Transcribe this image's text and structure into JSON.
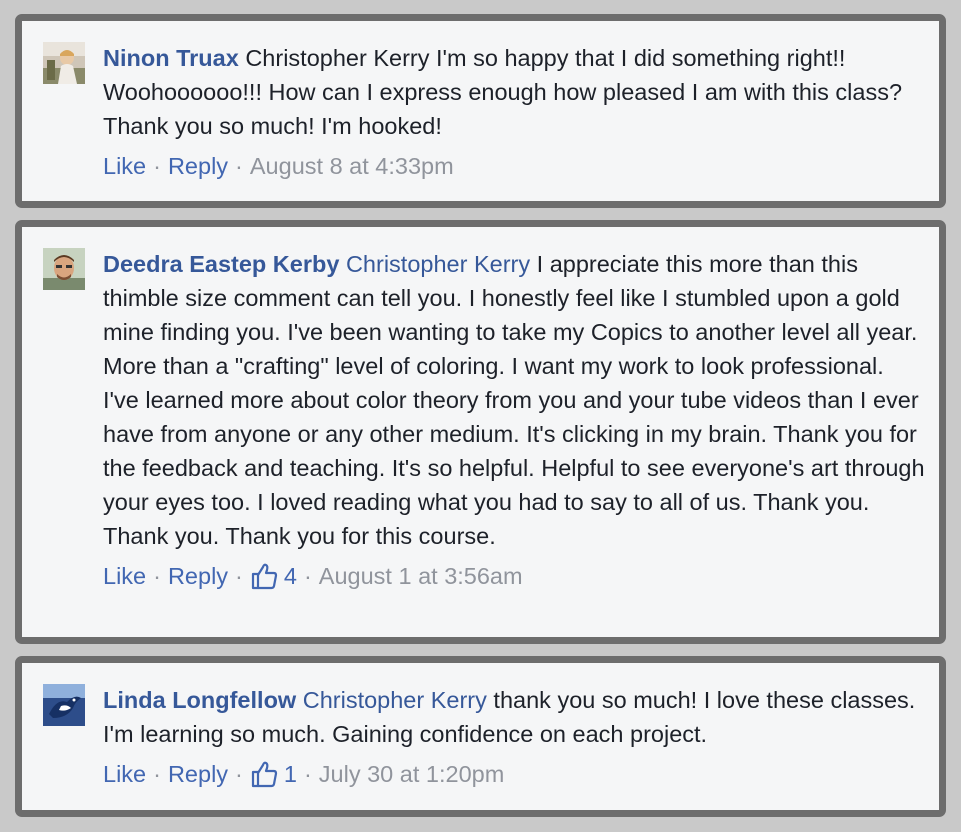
{
  "comments": [
    {
      "author": "Ninon Truax",
      "mention": "",
      "text": "Christopher Kerry I'm so happy that I did something right!! Woohoooooo!!! How can I express enough how pleased I am with this class? Thank you so much! I'm hooked!",
      "like_label": "Like",
      "reply_label": "Reply",
      "separator": "·",
      "like_count": "",
      "timestamp": "August 8 at 4:33pm",
      "avatar_icon": "photo-woman-sunlit"
    },
    {
      "author": "Deedra Eastep Kerby",
      "mention": "Christopher Kerry",
      "text": "I appreciate this more than this thimble size comment can tell you. I honestly feel like I stumbled upon a gold mine finding you. I've been wanting to take my Copics to another level all year. More than a \"crafting\" level of coloring. I want my work to look professional. I've learned more about color theory from you and your tube videos than I ever have from anyone or any other medium. It's clicking in my brain. Thank you for the feedback and teaching. It's so helpful. Helpful to see everyone's art through your eyes too. I loved reading what you had to say to all of us. Thank you. Thank you. Thank you for this course.",
      "like_label": "Like",
      "reply_label": "Reply",
      "separator": "·",
      "like_count": "4",
      "timestamp": "August 1 at 3:56am",
      "avatar_icon": "photo-man-portrait"
    },
    {
      "author": "Linda Longfellow",
      "mention": "Christopher Kerry",
      "text": "thank you so much! I love these classes. I'm learning so much. Gaining confidence on each project.",
      "like_label": "Like",
      "reply_label": "Reply",
      "separator": "·",
      "like_count": "1",
      "timestamp": "July 30 at 1:20pm",
      "avatar_icon": "photo-blue-bird"
    }
  ],
  "colors": {
    "link": "#365899",
    "action": "#4267b2",
    "meta": "#90949c",
    "text": "#1d2129",
    "card_bg": "#f5f6f7",
    "card_border": "#6d6d6d",
    "page_bg": "#c9c9c9"
  }
}
